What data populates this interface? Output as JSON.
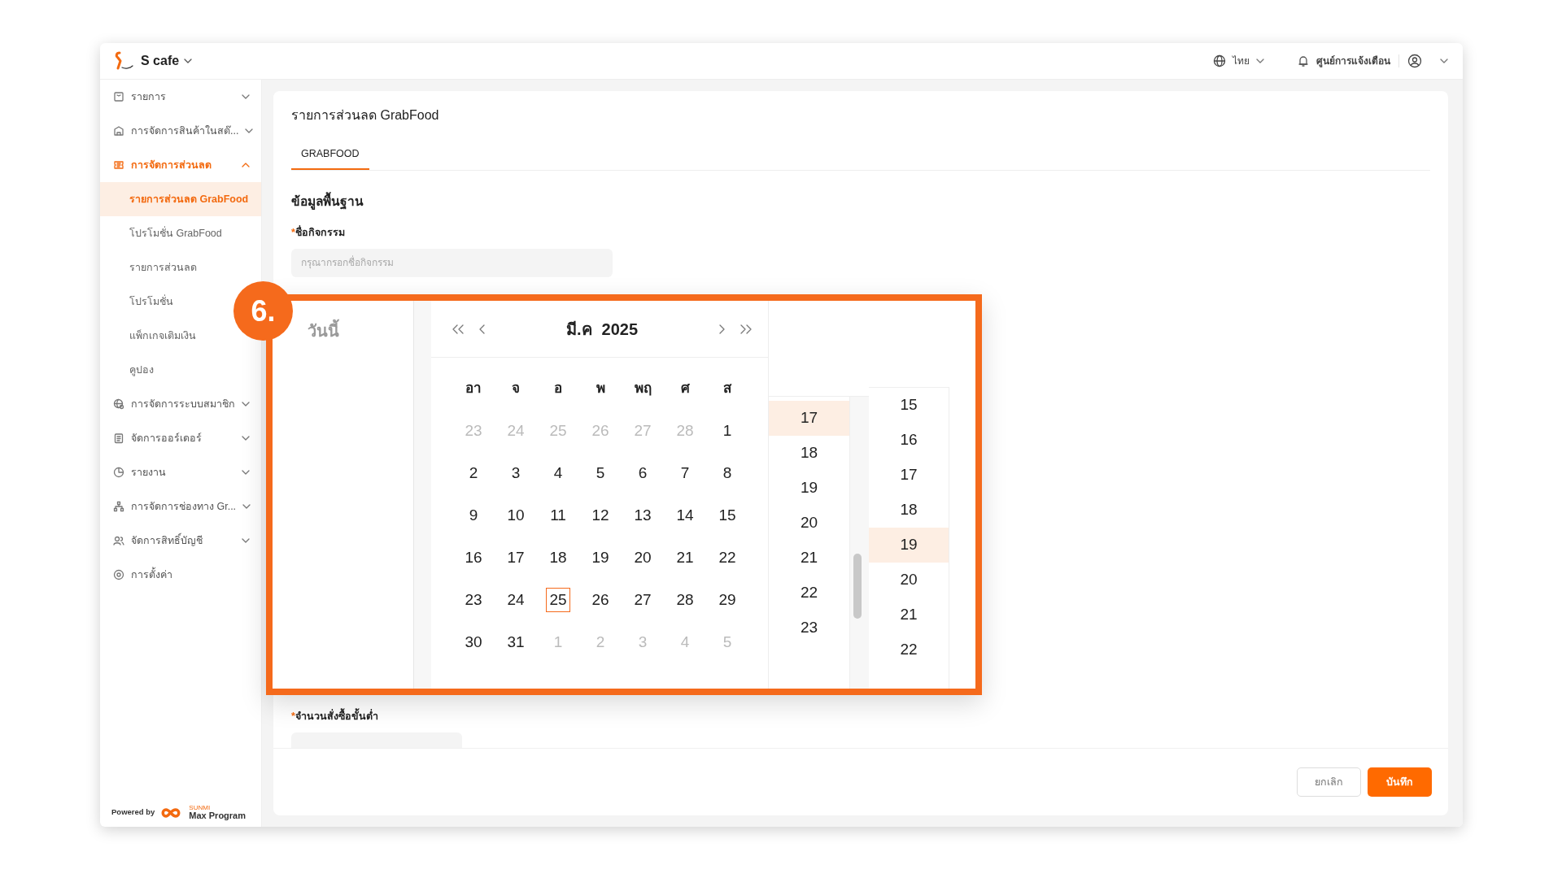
{
  "header": {
    "brand": "S cafe",
    "language": "ไทย",
    "notifications": "ศูนย์การแจ้งเตือน"
  },
  "sidebar": {
    "items": [
      {
        "label": "รายการ",
        "kind": "group",
        "expanded": false
      },
      {
        "label": "การจัดการสินค้าในสต๊...",
        "kind": "group",
        "expanded": false
      },
      {
        "label": "การจัดการส่วนลด",
        "kind": "group",
        "expanded": true,
        "children": [
          {
            "label": "รายการส่วนลด GrabFood",
            "selected": true
          },
          {
            "label": "โปรโมชั่น GrabFood",
            "selected": false
          },
          {
            "label": "รายการส่วนลด",
            "selected": false
          },
          {
            "label": "โปรโมชั่น",
            "selected": false
          },
          {
            "label": "แพ็กเกจเติมเงิน",
            "selected": false
          },
          {
            "label": "คูปอง",
            "selected": false
          }
        ]
      },
      {
        "label": "การจัดการระบบสมาชิก",
        "kind": "group",
        "expanded": false
      },
      {
        "label": "จัดการออร์เดอร์",
        "kind": "group",
        "expanded": false
      },
      {
        "label": "รายงาน",
        "kind": "group",
        "expanded": false
      },
      {
        "label": "การจัดการช่องทาง Gr...",
        "kind": "group",
        "expanded": false
      },
      {
        "label": "จัดการสิทธิ์บัญชี",
        "kind": "group",
        "expanded": false
      },
      {
        "label": "การตั้งค่า",
        "kind": "link"
      }
    ],
    "powered_by": "Powered by",
    "partner_small": "SUNMI",
    "partner_name": "Max Program"
  },
  "page": {
    "title": "รายการส่วนลด GrabFood",
    "tabs": [
      {
        "label": "GRABFOOD",
        "selected": true
      }
    ],
    "section": "ข้อมูลพื้นฐาน",
    "fields": [
      {
        "label": "ชื่อกิจกรรม",
        "required_mark": "*",
        "placeholder": "กรุณากรอกชื่อกิจกรรม"
      },
      {
        "label": "จำนวนสั่งซื้อขั้นต่ำ",
        "required_mark": "*"
      }
    ],
    "buttons": [
      {
        "label": "ยกเลิก",
        "kind": "secondary"
      },
      {
        "label": "บันทึก",
        "kind": "primary"
      }
    ]
  },
  "callout": {
    "step": "6.",
    "today_label": "วันนี้",
    "month": "มี.ค",
    "year": "2025",
    "weekdays": [
      "อา",
      "จ",
      "อ",
      "พ",
      "พฤ",
      "ศ",
      "ส"
    ],
    "days": [
      {
        "day": "23",
        "in_month": false,
        "today": false
      },
      {
        "day": "24",
        "in_month": false,
        "today": false
      },
      {
        "day": "25",
        "in_month": false,
        "today": false
      },
      {
        "day": "26",
        "in_month": false,
        "today": false
      },
      {
        "day": "27",
        "in_month": false,
        "today": false
      },
      {
        "day": "28",
        "in_month": false,
        "today": false
      },
      {
        "day": "1",
        "in_month": true,
        "today": false
      },
      {
        "day": "2",
        "in_month": true,
        "today": false
      },
      {
        "day": "3",
        "in_month": true,
        "today": false
      },
      {
        "day": "4",
        "in_month": true,
        "today": false
      },
      {
        "day": "5",
        "in_month": true,
        "today": false
      },
      {
        "day": "6",
        "in_month": true,
        "today": false
      },
      {
        "day": "7",
        "in_month": true,
        "today": false
      },
      {
        "day": "8",
        "in_month": true,
        "today": false
      },
      {
        "day": "9",
        "in_month": true,
        "today": false
      },
      {
        "day": "10",
        "in_month": true,
        "today": false
      },
      {
        "day": "11",
        "in_month": true,
        "today": false
      },
      {
        "day": "12",
        "in_month": true,
        "today": false
      },
      {
        "day": "13",
        "in_month": true,
        "today": false
      },
      {
        "day": "14",
        "in_month": true,
        "today": false
      },
      {
        "day": "15",
        "in_month": true,
        "today": false
      },
      {
        "day": "16",
        "in_month": true,
        "today": false
      },
      {
        "day": "17",
        "in_month": true,
        "today": false
      },
      {
        "day": "18",
        "in_month": true,
        "today": false
      },
      {
        "day": "19",
        "in_month": true,
        "today": false
      },
      {
        "day": "20",
        "in_month": true,
        "today": false
      },
      {
        "day": "21",
        "in_month": true,
        "today": false
      },
      {
        "day": "22",
        "in_month": true,
        "today": false
      },
      {
        "day": "23",
        "in_month": true,
        "today": false
      },
      {
        "day": "24",
        "in_month": true,
        "today": false
      },
      {
        "day": "25",
        "in_month": true,
        "today": true
      },
      {
        "day": "26",
        "in_month": true,
        "today": false
      },
      {
        "day": "27",
        "in_month": true,
        "today": false
      },
      {
        "day": "28",
        "in_month": true,
        "today": false
      },
      {
        "day": "29",
        "in_month": true,
        "today": false
      },
      {
        "day": "30",
        "in_month": true,
        "today": false
      },
      {
        "day": "31",
        "in_month": true,
        "today": false
      },
      {
        "day": "1",
        "in_month": false,
        "today": false
      },
      {
        "day": "2",
        "in_month": false,
        "today": false
      },
      {
        "day": "3",
        "in_month": false,
        "today": false
      },
      {
        "day": "4",
        "in_month": false,
        "today": false
      },
      {
        "day": "5",
        "in_month": false,
        "today": false
      }
    ],
    "hours": [
      {
        "label": "17",
        "selected": true
      },
      {
        "label": "18",
        "selected": false
      },
      {
        "label": "19",
        "selected": false
      },
      {
        "label": "20",
        "selected": false
      },
      {
        "label": "21",
        "selected": false
      },
      {
        "label": "22",
        "selected": false
      },
      {
        "label": "23",
        "selected": false
      }
    ],
    "minutes": [
      {
        "label": "15",
        "selected": false
      },
      {
        "label": "16",
        "selected": false
      },
      {
        "label": "17",
        "selected": false
      },
      {
        "label": "18",
        "selected": false
      },
      {
        "label": "19",
        "selected": true
      },
      {
        "label": "20",
        "selected": false
      },
      {
        "label": "21",
        "selected": false
      },
      {
        "label": "22",
        "selected": false
      }
    ]
  }
}
